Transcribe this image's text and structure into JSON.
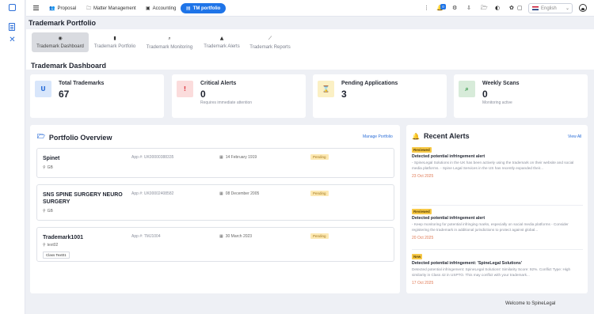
{
  "colors": {
    "accent": "#1e74e8",
    "pending": "#fde9b3",
    "alert_red": "#e0434b",
    "date_orange": "#e07a55"
  },
  "leftbar": {
    "icons": [
      "document-icon",
      "tools-icon"
    ]
  },
  "topbar": {
    "nav": [
      {
        "label": "Proposal",
        "icon": "people-icon"
      },
      {
        "label": "Matter Management",
        "icon": "folder-icon"
      },
      {
        "label": "Accounting",
        "icon": "ledger-icon"
      },
      {
        "label": "TM portfolio",
        "icon": "tm-icon"
      }
    ],
    "notification_count": "0",
    "language": "English"
  },
  "page": {
    "title": "Trademark Portfolio",
    "dashboard_title": "Trademark Dashboard"
  },
  "subtabs": [
    {
      "label": "Trademark Dashboard",
      "icon": "gauge-icon"
    },
    {
      "label": "Trademark Portfolio",
      "icon": "file-icon"
    },
    {
      "label": "Trademark Monitoring",
      "icon": "search-icon"
    },
    {
      "label": "Trademark Alerts",
      "icon": "warning-icon"
    },
    {
      "label": "Trademark Reports",
      "icon": "chart-line-icon"
    }
  ],
  "stats": [
    {
      "label": "Total Trademarks",
      "value": "67",
      "sub": "",
      "glyph": "U"
    },
    {
      "label": "Critical Alerts",
      "value": "0",
      "sub": "Requires immediate attention",
      "glyph": "!"
    },
    {
      "label": "Pending Applications",
      "value": "3",
      "sub": "",
      "glyph": "⌛"
    },
    {
      "label": "Weekly Scans",
      "value": "0",
      "sub": "Monitoring active",
      "glyph": "⌕"
    }
  ],
  "portfolio": {
    "title": "Portfolio Overview",
    "link": "Manage Portfolio",
    "items": [
      {
        "name": "Spinet",
        "app": "App #: UK00000388335",
        "date": "14 February 1919",
        "status": "Pending",
        "location": "GB",
        "class": ""
      },
      {
        "name": "SNS SPINE SURGERY NEURO SURGERY",
        "app": "App #: UK00002408582",
        "date": "08 December 2005",
        "status": "Pending",
        "location": "GB",
        "class": ""
      },
      {
        "name": "Trademark1001",
        "app": "App #: TMJ1004",
        "date": "30 March 2023",
        "status": "Pending",
        "location": "text02",
        "class": "Class Text01"
      }
    ]
  },
  "alerts": {
    "title": "Recent Alerts",
    "link": "View All",
    "items": [
      {
        "badge": "Reviewed",
        "title": "Detected potential infringement alert",
        "desc": "- SpineLegal Solutions in the UK has been actively using the trademark on their website and social media platforms. - Spine Legal Services in the US has recently expanded their...",
        "date": "23 Oct 2025"
      },
      {
        "badge": "Reviewed",
        "title": "Detected potential infringement alert",
        "desc": "- Keep monitoring for potential infringing marks, especially on social media platforms - Consider registering the trademark in additional jurisdictions to protect against global...",
        "date": "20 Oct 2025"
      },
      {
        "badge": "New",
        "title": "Detected potential infringement: 'SpineLegal Solutions'",
        "desc": "Detected potential infringement: SpineLegal Solutions' Similarity Score: 92%. Conflict Type: High similarity in Class 42 in USPTO. This may conflict with your trademark...",
        "date": "17 Oct 2025"
      }
    ]
  },
  "footer": {
    "text": "Welcome to SpineLegal"
  }
}
